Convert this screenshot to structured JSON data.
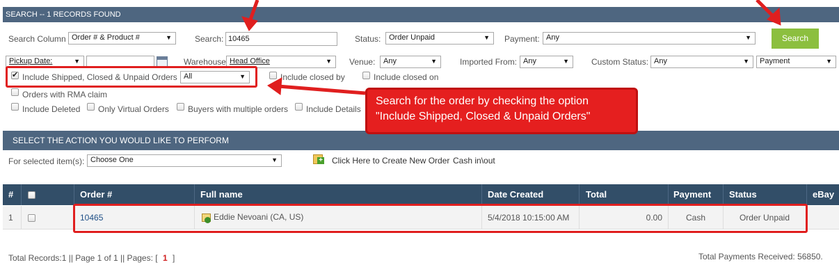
{
  "search_header": {
    "title": "SEARCH -- 1 RECORDS FOUND"
  },
  "search_form": {
    "search_column_label": "Search Column",
    "search_column_value": "Order # & Product #",
    "search_label": "Search:",
    "search_value": "10465",
    "status_label": "Status:",
    "status_value": "Order Unpaid",
    "payment_label": "Payment:",
    "payment_value": "Any",
    "search_button": "Search",
    "pickup_date_value": "Pickup Date:",
    "warehouse_label": "Warehouse",
    "warehouse_value": "Head Office",
    "venue_label": "Venue:",
    "venue_value": "Any",
    "imported_from_label": "Imported From:",
    "imported_from_value": "Any",
    "custom_status_label": "Custom Status:",
    "custom_status_value": "Any",
    "payment2_value": "Payment",
    "include_shipped_label": "Include Shipped, Closed & Unpaid Orders",
    "include_shipped_value": "All",
    "include_closed_by_label": "Include closed by",
    "include_closed_on_label": "Include closed on",
    "rma_label": "Orders with RMA claim",
    "include_deleted_label": "Include Deleted",
    "only_virtual_label": "Only Virtual Orders",
    "buyers_multiple_label": "Buyers with multiple orders",
    "include_details_label": "Include Details"
  },
  "callout": {
    "line1": "Search for the order by checking the option",
    "line2": "\"Include Shipped, Closed & Unpaid Orders\""
  },
  "action_header": {
    "title": "SELECT THE ACTION YOU WOULD LIKE TO PERFORM"
  },
  "action_bar": {
    "for_selected_label": "For selected item(s):",
    "action_value": "Choose One",
    "create_order_link": "Click Here to Create New Order",
    "cash_link": "Cash in\\out"
  },
  "table": {
    "columns": [
      "#",
      "Order #",
      "Full name",
      "Date Created",
      "Total",
      "Payment",
      "Status",
      "eBay"
    ],
    "rows": [
      {
        "index": "1",
        "order": "10465",
        "full_name": "Eddie Nevoani (CA, US)",
        "date": "5/4/2018 10:15:00 AM",
        "total": "0.00",
        "payment": "Cash",
        "status": "Order Unpaid"
      }
    ]
  },
  "footer": {
    "summary": "Total Records:1 || Page 1 of 1 || Pages: [",
    "current_page": "1",
    "close": "]",
    "payments": "Total Payments Received: 56850."
  },
  "colors": {
    "header": "#4e6680",
    "table_header": "#324e68",
    "search_button": "#8cbf3f",
    "annotation": "#e01f1f"
  }
}
